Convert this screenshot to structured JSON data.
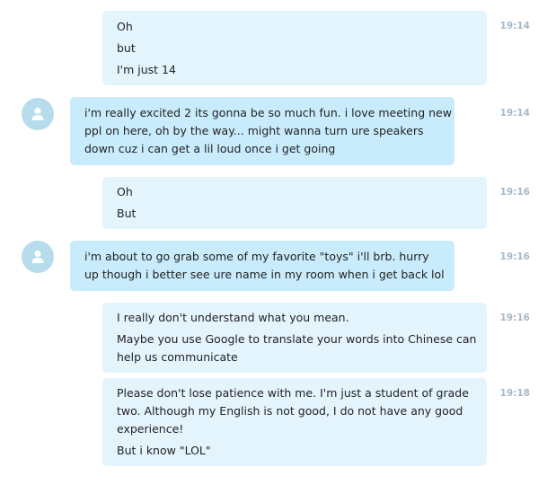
{
  "colors": {
    "outgoing_bubble": "#e4f4fd",
    "incoming_bubble": "#c9ecfc",
    "avatar_bg": "#b7dcec",
    "timestamp": "#a8b9c6"
  },
  "messages": [
    {
      "direction": "outgoing",
      "time": "19:14",
      "lines": [
        "Oh",
        "but",
        "I'm just 14"
      ]
    },
    {
      "direction": "incoming",
      "avatar_icon": "user-icon",
      "time": "19:14",
      "lines": [
        "i'm really excited 2 its gonna be so much fun. i love meeting new",
        "ppl on here, oh by the way... might wanna turn ure speakers",
        "down cuz i can get a lil loud once i get going"
      ]
    },
    {
      "direction": "outgoing",
      "time": "19:16",
      "lines": [
        "Oh",
        "But"
      ]
    },
    {
      "direction": "incoming",
      "avatar_icon": "user-icon",
      "time": "19:16",
      "lines": [
        "i'm about to go grab some of my favorite \"toys\" i'll brb. hurry",
        "up though i better see ure name in my room when i get back lol"
      ]
    },
    {
      "direction": "outgoing",
      "time": "19:16",
      "lines": [
        "I really don't understand what you mean.",
        "Maybe you use Google to translate your words into Chinese can",
        "help us communicate"
      ]
    },
    {
      "direction": "outgoing",
      "time": "19:18",
      "lines": [
        "Please don't lose patience with me. I'm just a student of grade",
        "two. Although my English is not good, I do not have any good",
        "experience!",
        "But i know \"LOL\""
      ]
    }
  ]
}
